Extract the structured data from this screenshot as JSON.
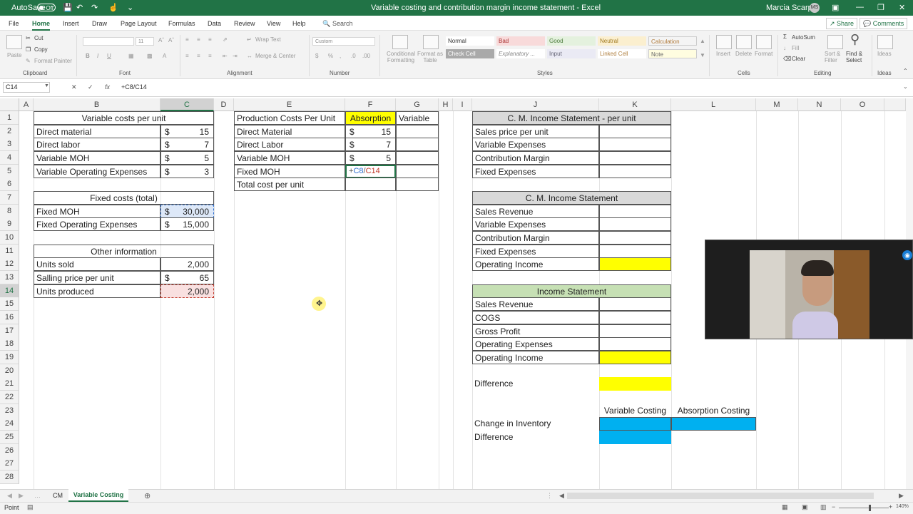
{
  "titlebar": {
    "autosave": "AutoSave",
    "autosave_state": "Off",
    "title": "Variable costing and contribution margin income statement  -  Excel",
    "user": "Marcia Scarpin",
    "initials": "MS"
  },
  "tabs": [
    "File",
    "Home",
    "Insert",
    "Draw",
    "Page Layout",
    "Formulas",
    "Data",
    "Review",
    "View",
    "Help"
  ],
  "search": "Search",
  "share": "Share",
  "comments": "Comments",
  "ribbon": {
    "paste": "Paste",
    "cut": "Cut",
    "copy": "Copy",
    "format_painter": "Format Painter",
    "clipboard": "Clipboard",
    "font_size": "11",
    "font": "Font",
    "wrap_text": "Wrap Text",
    "merge_center": "Merge & Center",
    "alignment": "Alignment",
    "number_format": "Custom",
    "number": "Number",
    "conditional_formatting": "Conditional Formatting",
    "format_as_table": "Format as Table",
    "styles": {
      "normal": "Normal",
      "bad": "Bad",
      "good": "Good",
      "neutral": "Neutral",
      "calculation": "Calculation",
      "check_cell": "Check Cell",
      "explanatory": "Explanatory ...",
      "input": "Input",
      "linked_cell": "Linked Cell",
      "note": "Note"
    },
    "styles_label": "Styles",
    "insert": "Insert",
    "delete": "Delete",
    "format": "Format",
    "cells": "Cells",
    "autosum": "AutoSum",
    "fill": "Fill",
    "clear": "Clear",
    "sort_filter": "Sort & Filter",
    "find_select": "Find & Select",
    "editing": "Editing",
    "ideas": "Ideas",
    "ideas_label": "Ideas"
  },
  "formula_bar": {
    "name_box": "C14",
    "cancel": "✕",
    "enter": "✓",
    "fx": "fx",
    "formula": "+C8/C14"
  },
  "columns": [
    "A",
    "B",
    "C",
    "D",
    "E",
    "F",
    "G",
    "H",
    "I",
    "J",
    "K",
    "L",
    "M",
    "N",
    "O"
  ],
  "rows": [
    "1",
    "2",
    "3",
    "4",
    "5",
    "6",
    "7",
    "8",
    "9",
    "10",
    "11",
    "12",
    "13",
    "14",
    "15",
    "16",
    "17",
    "18",
    "19",
    "20",
    "21",
    "22",
    "23",
    "24",
    "25",
    "26",
    "27",
    "28"
  ],
  "cells": {
    "B1": "Variable costs per unit",
    "B2": "Direct material",
    "C2_sym": "$",
    "C2": "15",
    "B3": "Direct labor",
    "C3_sym": "$",
    "C3": "7",
    "B4": "Variable MOH",
    "C4_sym": "$",
    "C4": "5",
    "B5": "Variable Operating Expenses",
    "C5_sym": "$",
    "C5": "3",
    "B7": "Fixed costs (total)",
    "B8": "Fixed MOH",
    "C8_sym": "$",
    "C8": "30,000",
    "B9": "Fixed Operating Expenses",
    "C9_sym": "$",
    "C9": "15,000",
    "B11": "Other information",
    "B12": "Units sold",
    "C12": "2,000",
    "B13": "Salling price per unit",
    "C13_sym": "$",
    "C13": "65",
    "B14": "Units produced",
    "C14": "2,000",
    "E1": "Production Costs Per Unit",
    "F1": "Absorption",
    "G1": "Variable",
    "E2": "Direct Material",
    "F2_sym": "$",
    "F2": "15",
    "E3": "Direct Labor",
    "F3_sym": "$",
    "F3": "7",
    "E4": "Variable MOH",
    "F4_sym": "$",
    "F4": "5",
    "E5": "Fixed MOH",
    "F5_ref1": "C8",
    "F5_op": "/",
    "F5_ref2": "C14",
    "E6": "Total cost per unit",
    "J1": "C. M. Income Statement - per unit",
    "J2": "Sales price per unit",
    "J3": "Variable Expenses",
    "J4": "Contribution Margin",
    "J5": "Fixed Expenses",
    "J7": "C. M. Income Statement",
    "J8": "Sales Revenue",
    "J9": "Variable Expenses",
    "J10": "Contribution Margin",
    "J11": "Fixed Expenses",
    "J12": "Operating Income",
    "J14": "Income Statement",
    "J15": "Sales Revenue",
    "J16": "COGS",
    "J17": "Gross Profit",
    "J18": "Operating Expenses",
    "J19": "Operating Income",
    "J21": "Difference",
    "K23": "Variable Costing",
    "L23": "Absorption Costing",
    "J24": "Change in Inventory",
    "J25": "Difference"
  },
  "sheets": [
    "CM",
    "Variable Costing"
  ],
  "active_sheet": "Variable Costing",
  "status": "Point",
  "zoom": "140%",
  "colors": {
    "excel_green": "#217346",
    "yellow": "#ffff00",
    "blue": "#00b0f0",
    "green_fill": "#c6e0b4",
    "gray_fill": "#d9d9d9"
  }
}
